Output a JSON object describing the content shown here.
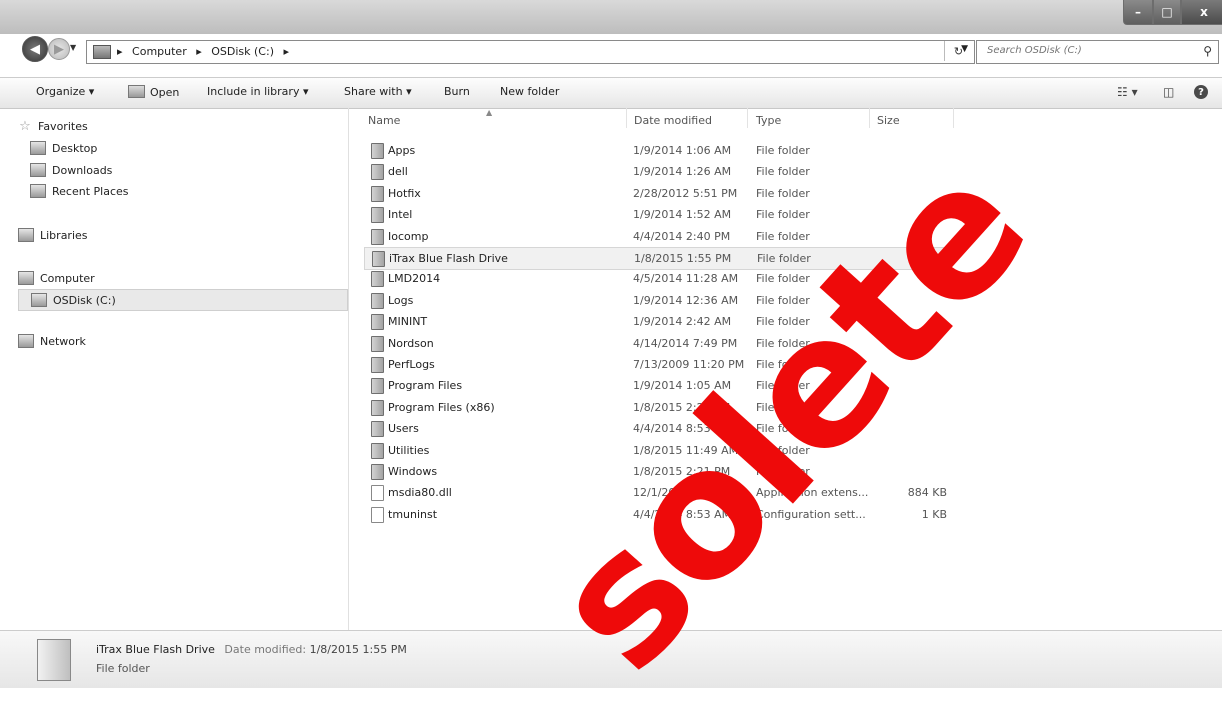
{
  "window": {
    "controls": {
      "minimize": "–",
      "maximize": "□",
      "close": "x"
    }
  },
  "address": {
    "crumbs": [
      "Computer",
      "OSDisk (C:)"
    ],
    "separator": "▸",
    "search_placeholder": "Search OSDisk (C:)"
  },
  "toolbar": {
    "organize": "Organize ▾",
    "open": "Open",
    "include_in_library": "Include in library ▾",
    "share_with": "Share with ▾",
    "burn": "Burn",
    "new_folder": "New folder",
    "help": "?"
  },
  "nav": {
    "favorites": "Favorites",
    "desktop": "Desktop",
    "downloads": "Downloads",
    "recent_places": "Recent Places",
    "libraries": "Libraries",
    "computer": "Computer",
    "osdisk": "OSDisk (C:)",
    "network": "Network"
  },
  "columns": {
    "name": "Name",
    "date": "Date modified",
    "type": "Type",
    "size": "Size"
  },
  "files": [
    {
      "name": "Apps",
      "date": "1/9/2014 1:06 AM",
      "type": "File folder",
      "size": ""
    },
    {
      "name": "dell",
      "date": "1/9/2014 1:26 AM",
      "type": "File folder",
      "size": ""
    },
    {
      "name": "Hotfix",
      "date": "2/28/2012 5:51 PM",
      "type": "File folder",
      "size": ""
    },
    {
      "name": "Intel",
      "date": "1/9/2014 1:52 AM",
      "type": "File folder",
      "size": ""
    },
    {
      "name": "Iocomp",
      "date": "4/4/2014 2:40 PM",
      "type": "File folder",
      "size": ""
    },
    {
      "name": "iTrax Blue Flash Drive",
      "date": "1/8/2015 1:55 PM",
      "type": "File folder",
      "size": ""
    },
    {
      "name": "LMD2014",
      "date": "4/5/2014 11:28 AM",
      "type": "File folder",
      "size": ""
    },
    {
      "name": "Logs",
      "date": "1/9/2014 12:36 AM",
      "type": "File folder",
      "size": ""
    },
    {
      "name": "MININT",
      "date": "1/9/2014 2:42 AM",
      "type": "File folder",
      "size": ""
    },
    {
      "name": "Nordson",
      "date": "4/14/2014 7:49 PM",
      "type": "File folder",
      "size": ""
    },
    {
      "name": "PerfLogs",
      "date": "7/13/2009 11:20 PM",
      "type": "File folder",
      "size": ""
    },
    {
      "name": "Program Files",
      "date": "1/9/2014 1:05 AM",
      "type": "File folder",
      "size": ""
    },
    {
      "name": "Program Files (x86)",
      "date": "1/8/2015 2:22 PM",
      "type": "File folder",
      "size": ""
    },
    {
      "name": "Users",
      "date": "4/4/2014 8:53 AM",
      "type": "File folder",
      "size": ""
    },
    {
      "name": "Utilities",
      "date": "1/8/2015 11:49 AM",
      "type": "File folder",
      "size": ""
    },
    {
      "name": "Windows",
      "date": "1/8/2015 2:21 PM",
      "type": "File folder",
      "size": ""
    },
    {
      "name": "msdia80.dll",
      "date": "12/1/2006 10:37 PM",
      "type": "Application extens...",
      "size": "884 KB"
    },
    {
      "name": "tmuninst",
      "date": "4/4/2014 8:53 AM",
      "type": "Configuration sett...",
      "size": "1 KB"
    }
  ],
  "details": {
    "name": "iTrax Blue Flash Drive",
    "date_label": "Date modified:",
    "date_value": "1/8/2015 1:55 PM",
    "type": "File folder"
  },
  "watermark": "solete"
}
